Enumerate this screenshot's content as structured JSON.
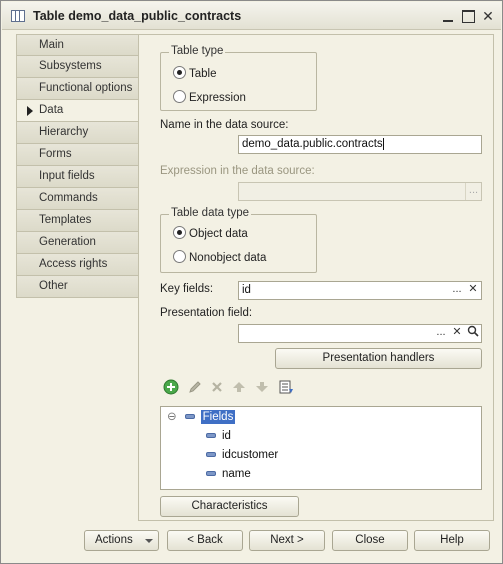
{
  "window": {
    "title": "Table demo_data_public_contracts",
    "minimize_glyph": "",
    "maximize_glyph": "",
    "close_glyph": "✕"
  },
  "nav": {
    "items": [
      {
        "label": "Main"
      },
      {
        "label": "Subsystems"
      },
      {
        "label": "Functional options"
      },
      {
        "label": "Data"
      },
      {
        "label": "Hierarchy"
      },
      {
        "label": "Forms"
      },
      {
        "label": "Input fields"
      },
      {
        "label": "Commands"
      },
      {
        "label": "Templates"
      },
      {
        "label": "Generation"
      },
      {
        "label": "Access rights"
      },
      {
        "label": "Other"
      }
    ],
    "active": "Data"
  },
  "table_type": {
    "title": "Table type",
    "options": [
      "Table",
      "Expression"
    ],
    "selected": "Table"
  },
  "data_source": {
    "label": "Name in the data source:",
    "value": "demo_data.public.contracts"
  },
  "expression": {
    "label": "Expression in the data source:",
    "value": "",
    "button": "..."
  },
  "data_type": {
    "title": "Table data type",
    "options": [
      "Object data",
      "Nonobject data"
    ],
    "selected": "Object data"
  },
  "key_fields": {
    "label": "Key fields:",
    "value": "id",
    "select_button": "...",
    "clear_button": "✕"
  },
  "presentation": {
    "label": "Presentation field:",
    "value": "",
    "select_button": "...",
    "clear_button": "✕",
    "handlers_button": "Presentation handlers"
  },
  "toolbar": {
    "icons": [
      "add-icon",
      "edit-icon",
      "delete-icon",
      "move-up-icon",
      "move-down-icon",
      "list-icon"
    ]
  },
  "tree": {
    "root": "Fields",
    "collapse_glyph": "⊖",
    "children": [
      "id",
      "idcustomer",
      "name"
    ]
  },
  "characteristics_button": "Characteristics",
  "bottom_buttons": {
    "actions": "Actions",
    "back": "< Back",
    "next": "Next >",
    "close": "Close",
    "help": "Help"
  },
  "colors": {
    "window_bg": "#f3f1e4",
    "selection": "#3f6fc5",
    "add_icon": "#3c9a3c"
  }
}
